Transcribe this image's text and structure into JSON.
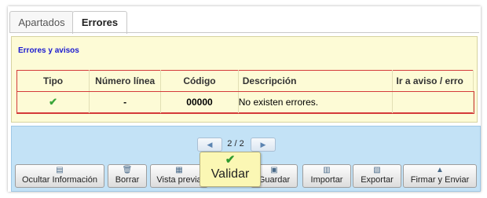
{
  "tabs": [
    {
      "label": "Apartados",
      "active": false
    },
    {
      "label": "Errores",
      "active": true
    }
  ],
  "panel": {
    "title": "Errores y avisos",
    "columns": [
      "Tipo",
      "Número línea",
      "Código",
      "Descripción",
      "Ir a aviso / erro"
    ],
    "rows": [
      {
        "tipo_icon": "check-icon",
        "numero_linea": "-",
        "codigo": "00000",
        "descripcion": "No existen errores.",
        "ir": ""
      }
    ]
  },
  "pager": {
    "prev": "◀",
    "text": "2 / 2",
    "next": "▶"
  },
  "buttons": [
    {
      "label": "Ocultar Información",
      "icon": "info-panel-icon"
    },
    {
      "label": "Borrar",
      "icon": "trash-icon"
    },
    {
      "label": "Vista previa",
      "icon": "preview-icon"
    },
    {
      "label": "Guardar",
      "icon": "save-icon"
    },
    {
      "label": "Importar",
      "icon": "import-icon"
    },
    {
      "label": "Exportar",
      "icon": "export-icon"
    },
    {
      "label": "Firmar y Enviar",
      "icon": "sign-send-icon"
    }
  ],
  "validar": {
    "label": "Validar",
    "icon": "check-icon"
  },
  "colors": {
    "accent_title": "#1a1ad0",
    "panel_bg": "#fdfbd6",
    "toolbar_bg": "#c3e2f6",
    "error_border": "#d43a3a",
    "check": "#3aa63a"
  }
}
